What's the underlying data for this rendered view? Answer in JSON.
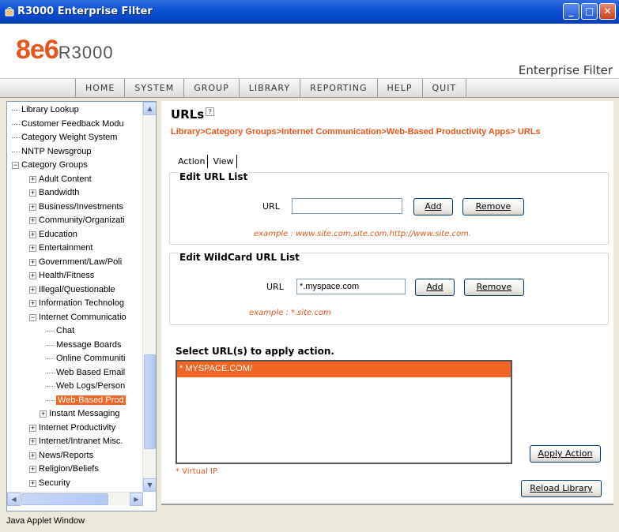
{
  "window": {
    "title": "R3000 Enterprise Filter"
  },
  "header": {
    "brand": "8e6",
    "product": "R3000",
    "tagline": "Enterprise Filter"
  },
  "menu": [
    "HOME",
    "SYSTEM",
    "GROUP",
    "LIBRARY",
    "REPORTING",
    "HELP",
    "QUIT"
  ],
  "tree": {
    "items": [
      {
        "label": "Library Lookup",
        "expander": ""
      },
      {
        "label": "Customer Feedback Modu",
        "expander": ""
      },
      {
        "label": "Category Weight System",
        "expander": ""
      },
      {
        "label": "NNTP Newsgroup",
        "expander": ""
      },
      {
        "label": "Category Groups",
        "expander": "−"
      },
      {
        "label": "Adult Content",
        "expander": "+"
      },
      {
        "label": "Bandwidth",
        "expander": "+"
      },
      {
        "label": "Business/Investments",
        "expander": "+"
      },
      {
        "label": "Community/Organizati",
        "expander": "+"
      },
      {
        "label": "Education",
        "expander": "+"
      },
      {
        "label": "Entertainment",
        "expander": "+"
      },
      {
        "label": "Government/Law/Poli",
        "expander": "+"
      },
      {
        "label": "Health/Fitness",
        "expander": "+"
      },
      {
        "label": "Illegal/Questionable",
        "expander": "+"
      },
      {
        "label": "Information Technolog",
        "expander": "+"
      },
      {
        "label": "Internet Communicatio",
        "expander": "−"
      },
      {
        "label": "Chat",
        "expander": ""
      },
      {
        "label": "Message Boards",
        "expander": ""
      },
      {
        "label": "Online Communiti",
        "expander": ""
      },
      {
        "label": "Web Based Email",
        "expander": ""
      },
      {
        "label": "Web Logs/Person",
        "expander": ""
      },
      {
        "label": "Web-Based Prod",
        "expander": ""
      },
      {
        "label": "Instant Messaging",
        "expander": "+"
      },
      {
        "label": "Internet Productivity",
        "expander": "+"
      },
      {
        "label": "Internet/Intranet Misc.",
        "expander": "+"
      },
      {
        "label": "News/Reports",
        "expander": "+"
      },
      {
        "label": "Religion/Beliefs",
        "expander": "+"
      },
      {
        "label": "Security",
        "expander": "+"
      }
    ]
  },
  "content": {
    "title": "URLs",
    "breadcrumb": "Library>Category Groups>Internet Communication>Web-Based Productivity Apps> URLs",
    "tabs": [
      "Action",
      "View"
    ],
    "edit_url": {
      "title": "Edit URL List",
      "label": "URL",
      "value": "",
      "add": "Add",
      "remove": "Remove",
      "example": "example : www.site.com,site.com,http://www.site.com."
    },
    "edit_wildcard": {
      "title": "Edit WildCard URL List",
      "label": "URL",
      "value": "*.myspace.com",
      "add": "Add",
      "remove": "Remove",
      "example": "example : *.site.com"
    },
    "select_title": "Select URL(s) to apply action.",
    "urls": [
      "* MYSPACE.COM/"
    ],
    "virtual_ip_note": "* Virtual IP",
    "apply_action": "Apply Action",
    "reload_library": "Reload Library"
  },
  "status_bar": "Java Applet Window",
  "colors": {
    "accent": "#f26522",
    "title_bar": "#0a4fd4"
  }
}
